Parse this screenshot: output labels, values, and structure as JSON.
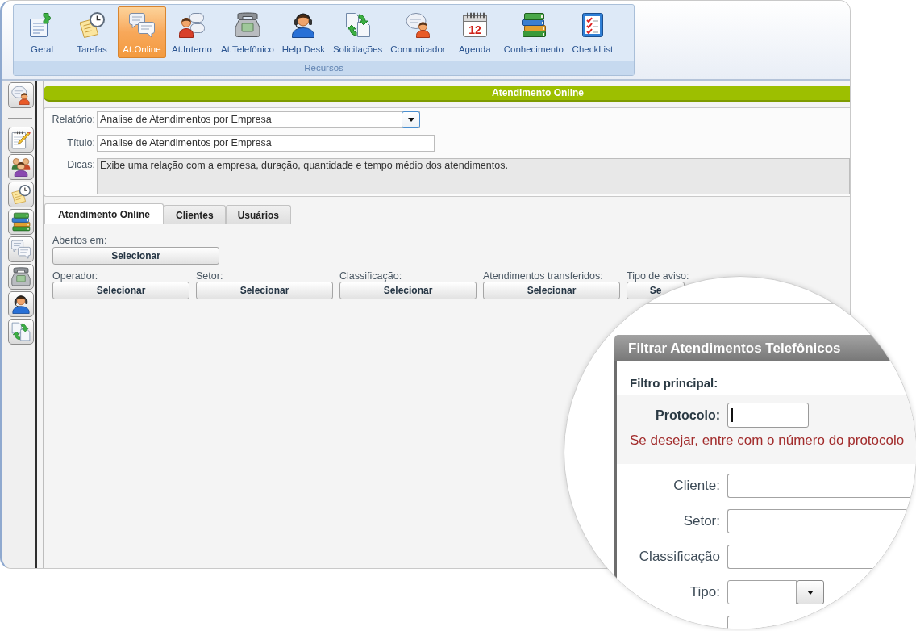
{
  "toolbar": {
    "items": [
      {
        "label": "Geral",
        "selected": false
      },
      {
        "label": "Tarefas",
        "selected": false
      },
      {
        "label": "At.Online",
        "selected": true
      },
      {
        "label": "At.Interno",
        "selected": false
      },
      {
        "label": "At.Telefônico",
        "selected": false
      },
      {
        "label": "Help Desk",
        "selected": false
      },
      {
        "label": "Solicitações",
        "selected": false
      },
      {
        "label": "Comunicador",
        "selected": false
      },
      {
        "label": "Agenda",
        "selected": false,
        "icon_text": "12"
      },
      {
        "label": "Conhecimento",
        "selected": false
      },
      {
        "label": "CheckList",
        "selected": false
      }
    ],
    "group_label": "Recursos"
  },
  "panel": {
    "title": "Atendimento Online"
  },
  "report_form": {
    "fields": [
      {
        "kind": "select",
        "label": "Relatório:",
        "value": "Analise de Atendimentos por Empresa"
      },
      {
        "kind": "text",
        "label": "Título:",
        "value": "Analise de Atendimentos por Empresa"
      },
      {
        "kind": "textarea",
        "label": "Dicas:",
        "value": "Exibe uma relação com a empresa, duração, quantidade e tempo médio dos atendimentos."
      }
    ]
  },
  "tabs": [
    {
      "label": "Atendimento Online",
      "selected": true
    },
    {
      "label": "Clientes",
      "selected": false
    },
    {
      "label": "Usuários",
      "selected": false
    }
  ],
  "filters": {
    "opened": {
      "label": "Abertos em:",
      "button": "Selecionar"
    },
    "row": [
      {
        "label": "Operador:",
        "button": "Selecionar"
      },
      {
        "label": "Setor:",
        "button": "Selecionar"
      },
      {
        "label": "Classificação:",
        "button": "Selecionar"
      },
      {
        "label": "Atendimentos transferidos:",
        "button": "Selecionar"
      },
      {
        "label": "Tipo de aviso:",
        "button": "Se"
      }
    ]
  },
  "magnifier": {
    "dialog_title": "Filtrar Atendimentos Telefônicos",
    "section_title": "Filtro principal:",
    "protocol": {
      "label": "Protocolo:",
      "focused": true
    },
    "hint": "Se desejar, entre com o número do protocolo",
    "fields": [
      {
        "kind": "text",
        "label": "Cliente:"
      },
      {
        "kind": "text",
        "label": "Setor:"
      },
      {
        "kind": "text",
        "label": "Classificação"
      },
      {
        "kind": "select",
        "label": "Tipo:"
      }
    ]
  }
}
